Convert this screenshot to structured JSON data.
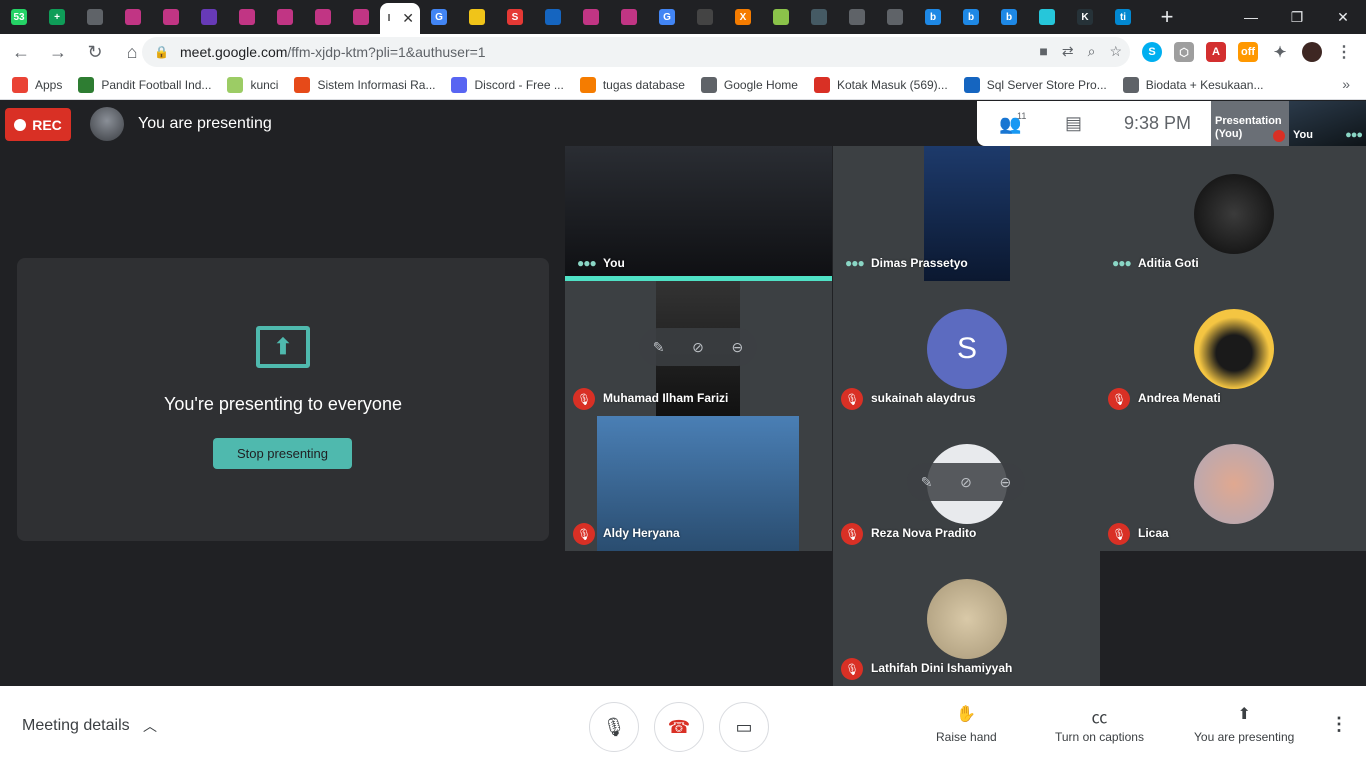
{
  "browser": {
    "tabs": [
      {
        "icon": "whatsapp-icon",
        "label": "53",
        "color": "#25d366"
      },
      {
        "icon": "sheets-icon",
        "label": "+",
        "color": "#0f9d58"
      },
      {
        "icon": "globe-icon",
        "label": "",
        "color": "#5f6368"
      },
      {
        "icon": "instagram-icon",
        "label": "",
        "color": "#c13584"
      },
      {
        "icon": "instagram-icon",
        "label": "",
        "color": "#c13584"
      },
      {
        "icon": "forms-icon",
        "label": "",
        "color": "#673ab7"
      },
      {
        "icon": "instagram-icon",
        "label": "",
        "color": "#c13584"
      },
      {
        "icon": "instagram-icon",
        "label": "",
        "color": "#c13584"
      },
      {
        "icon": "instagram-icon",
        "label": "",
        "color": "#c13584"
      },
      {
        "icon": "instagram-icon",
        "label": "",
        "color": "#c13584"
      }
    ],
    "active_tab_title": "I",
    "tabs_after": [
      {
        "icon": "google-icon",
        "label": "G",
        "color": "#4285f4"
      },
      {
        "icon": "tokopedia-icon",
        "label": "",
        "color": "#f0c419"
      },
      {
        "icon": "s-icon",
        "label": "S",
        "color": "#e53935"
      },
      {
        "icon": "graduation-icon",
        "label": "",
        "color": "#1565c0"
      },
      {
        "icon": "instagram-icon",
        "label": "",
        "color": "#c13584"
      },
      {
        "icon": "instagram-icon",
        "label": "",
        "color": "#c13584"
      },
      {
        "icon": "google-icon",
        "label": "G",
        "color": "#4285f4"
      },
      {
        "icon": "app-icon",
        "label": "",
        "color": "#444"
      },
      {
        "icon": "x-icon",
        "label": "X",
        "color": "#f57c00"
      },
      {
        "icon": "photos-icon",
        "label": "",
        "color": "#8bc34a"
      },
      {
        "icon": "site-icon",
        "label": "",
        "color": "#455a64"
      },
      {
        "icon": "globe-icon",
        "label": "",
        "color": "#5f6368"
      },
      {
        "icon": "globe-icon",
        "label": "",
        "color": "#5f6368"
      },
      {
        "icon": "b-icon",
        "label": "b",
        "color": "#1e88e5"
      },
      {
        "icon": "b-icon",
        "label": "b",
        "color": "#1e88e5"
      },
      {
        "icon": "b-icon",
        "label": "b",
        "color": "#1e88e5"
      },
      {
        "icon": "network-icon",
        "label": "",
        "color": "#26c6da"
      },
      {
        "icon": "k-icon",
        "label": "K",
        "color": "#263238"
      },
      {
        "icon": "ti-icon",
        "label": "ti",
        "color": "#0288d1"
      }
    ],
    "url_host": "meet.google.com",
    "url_path": "/ffm-xjdp-ktm?pli=1&authuser=1",
    "bookmarks": [
      {
        "label": "Apps",
        "color": "#ea4335"
      },
      {
        "label": "Pandit Football Ind...",
        "color": "#2e7d32"
      },
      {
        "label": "kunci",
        "color": "#9ccc65"
      },
      {
        "label": "Sistem Informasi Ra...",
        "color": "#e64a19"
      },
      {
        "label": "Discord - Free ...",
        "color": "#5865f2"
      },
      {
        "label": "tugas database",
        "color": "#f57c00"
      },
      {
        "label": "Google Home",
        "color": "#5f6368"
      },
      {
        "label": "Kotak Masuk (569)...",
        "color": "#d93025"
      },
      {
        "label": "Sql Server Store Pro...",
        "color": "#1565c0"
      },
      {
        "label": "Biodata + Kesukaan...",
        "color": "#5f6368"
      }
    ]
  },
  "meet": {
    "rec_label": "REC",
    "presenting_label": "You are presenting",
    "people_count": "11",
    "time": "9:38  PM",
    "self_preview_pres": "Presentation (You)",
    "self_preview_you": "You",
    "card_title": "You're presenting to everyone",
    "stop_button": "Stop presenting",
    "participants": [
      {
        "name": "You",
        "muted": false
      },
      {
        "name": "Dimas Prassetyo",
        "muted": false
      },
      {
        "name": "Aditia Goti",
        "muted": false
      },
      {
        "name": "Muhamad Ilham Farizi",
        "muted": true
      },
      {
        "name": "sukainah alaydrus",
        "muted": true,
        "initial": "S"
      },
      {
        "name": "Andrea Menati",
        "muted": true
      },
      {
        "name": "Aldy Heryana",
        "muted": true
      },
      {
        "name": "Reza Nova Pradito",
        "muted": true
      },
      {
        "name": "Licaa",
        "muted": true
      },
      {
        "name": "Lathifah Dini Ishamiyyah",
        "muted": true
      }
    ],
    "bottom": {
      "meeting_details": "Meeting details",
      "raise_hand": "Raise hand",
      "captions": "Turn on captions",
      "presenting": "You are presenting"
    }
  }
}
